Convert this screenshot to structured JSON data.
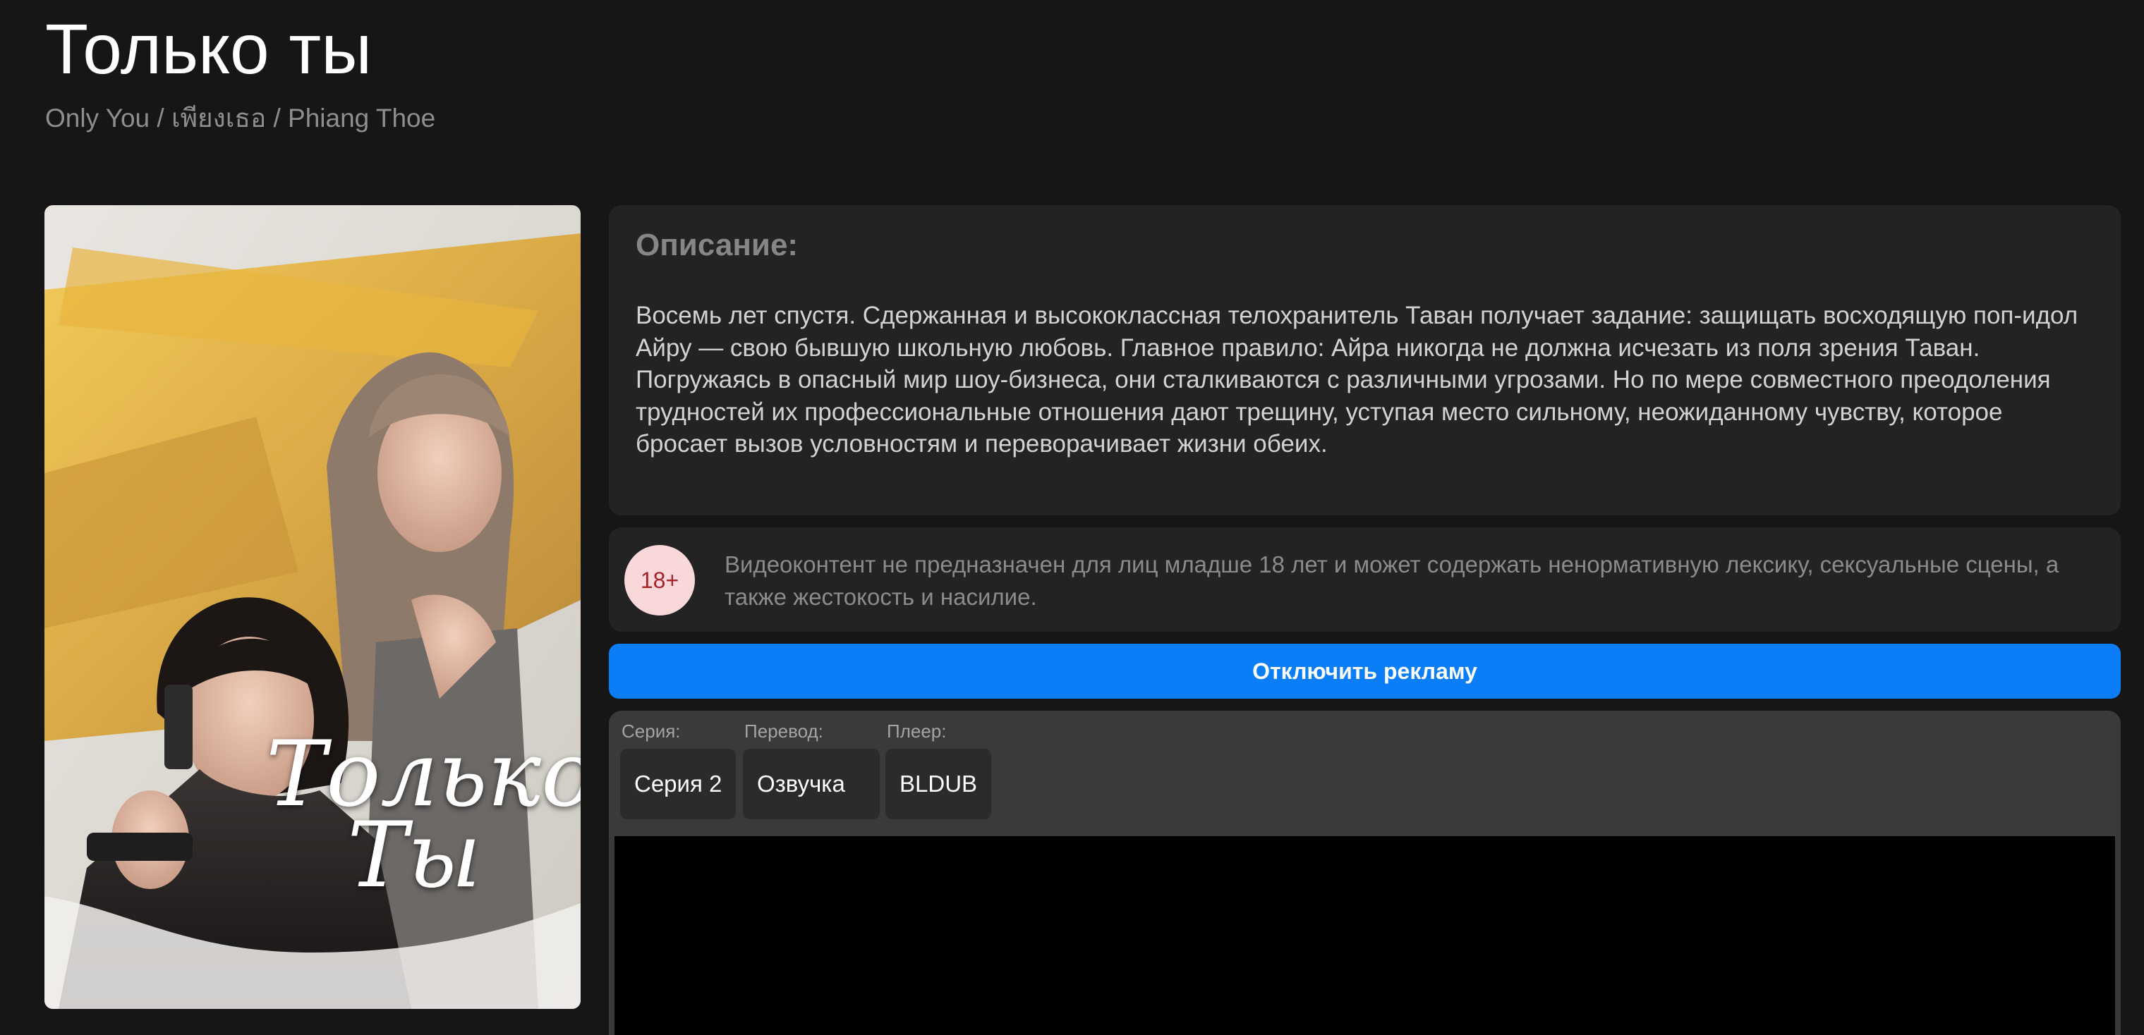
{
  "title": "Только ты",
  "subtitle": "Only You / เพียงเธอ / Phiang Thoe",
  "poster": {
    "title_text": "Только\nТы"
  },
  "description": {
    "heading": "Описание:",
    "text": "Восемь лет спустя. Сдержанная и высококлассная телохранитель Таван получает задание: защищать восходящую поп-идол Айру — свою бывшую школьную любовь. Главное правило: Айра никогда не должна исчезать из поля зрения Таван.\nПогружаясь в опасный мир шоу-бизнеса, они сталкиваются с различными угрозами. Но по мере совместного преодоления трудностей их профессиональные отношения дают трещину, уступая место сильному, неожиданному чувству, которое бросает вызов условностям и переворачивает жизни обеих."
  },
  "age_warning": {
    "badge": "18+",
    "text": "Видеоконтент не предназначен для лиц младше 18 лет и может содержать ненормативную лексику, сексуальные сцены, а также жестокость и насилие."
  },
  "ad_button_label": "Отключить рекламу",
  "player": {
    "episode_label": "Серия:",
    "episode_value": "Серия 2",
    "translation_label": "Перевод:",
    "translation_value": "Озвучка",
    "player_label": "Плеер:",
    "player_value": "BLDUB"
  },
  "colors": {
    "background": "#161617",
    "panel": "#232324",
    "accent": "#0b7df7",
    "badge_bg": "#f9d8da",
    "badge_text": "#a2252c"
  }
}
